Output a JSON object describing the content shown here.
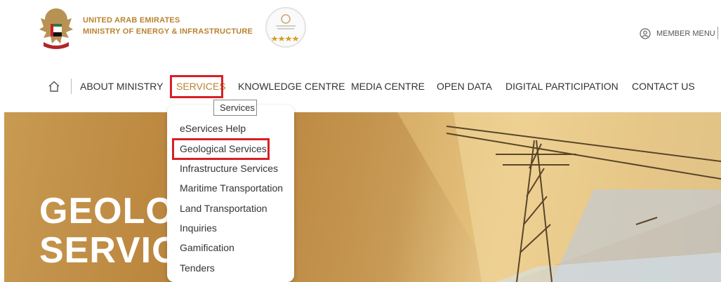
{
  "header": {
    "org_line1": "UNITED ARAB EMIRATES",
    "org_line2": "MINISTRY OF ENERGY & INFRASTRUCTURE",
    "member_menu": "MEMBER MENU"
  },
  "nav": {
    "items": [
      {
        "label": "ABOUT MINISTRY"
      },
      {
        "label": "SERVICES"
      },
      {
        "label": "KNOWLEDGE CENTRE"
      },
      {
        "label": "MEDIA CENTRE"
      },
      {
        "label": "OPEN DATA"
      },
      {
        "label": "DIGITAL PARTICIPATION"
      },
      {
        "label": "CONTACT US"
      }
    ],
    "active": "SERVICES"
  },
  "tooltip": "Services",
  "dropdown": {
    "items": [
      {
        "label": "eServices Help"
      },
      {
        "label": "Geological Services"
      },
      {
        "label": "Infrastructure Services"
      },
      {
        "label": "Maritime Transportation"
      },
      {
        "label": "Land Transportation"
      },
      {
        "label": "Inquiries"
      },
      {
        "label": "Gamification"
      },
      {
        "label": "Tenders"
      }
    ]
  },
  "hero": {
    "line1": "GEOLO",
    "line2": "SERVIC"
  },
  "colors": {
    "brand_gold": "#b8832f",
    "highlight_red": "#d81f26"
  },
  "icons": {
    "home": "home-icon",
    "member": "user-circle-icon"
  }
}
